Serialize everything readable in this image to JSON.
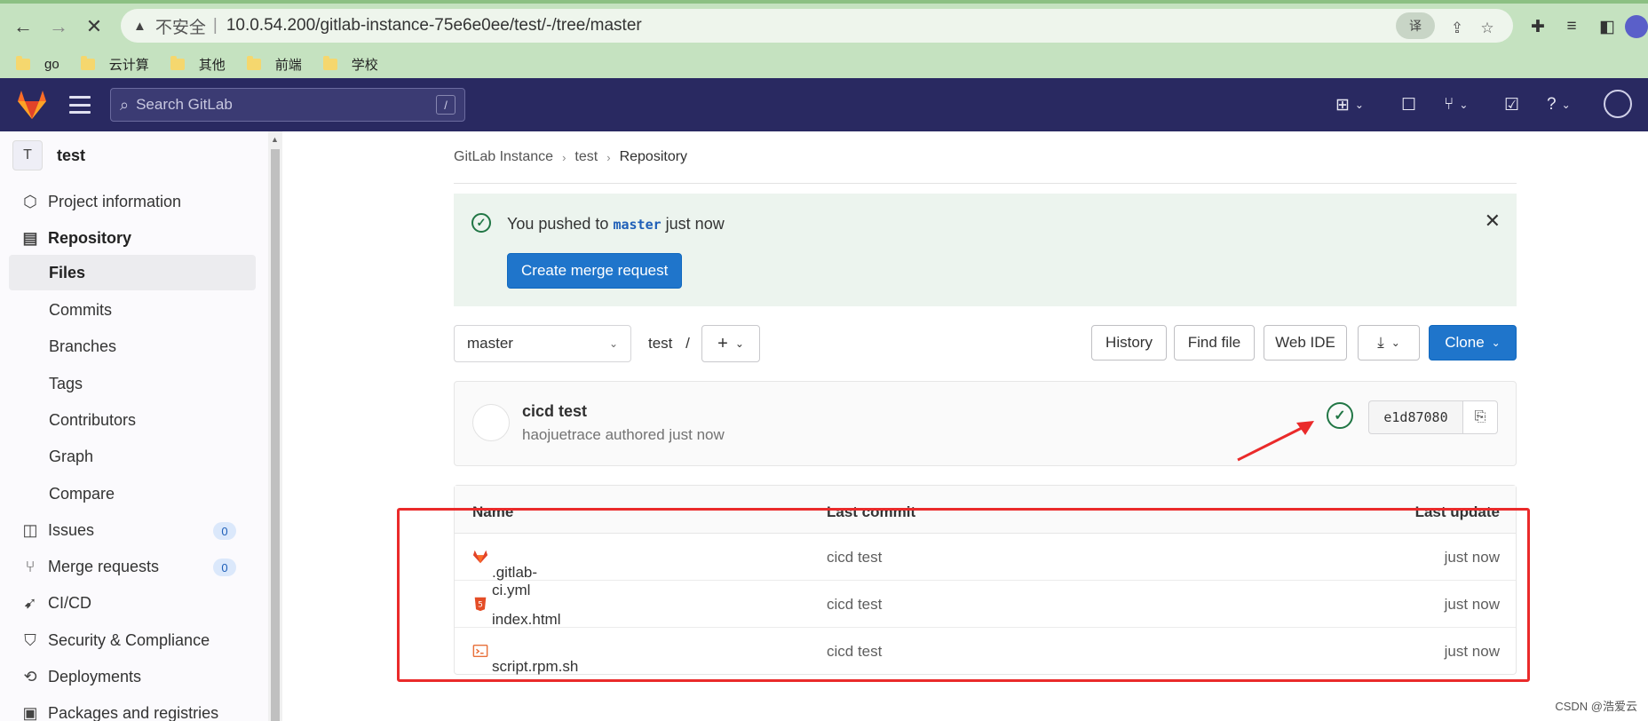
{
  "browser": {
    "insecure_label": "不安全",
    "separator": "|",
    "url": "10.0.54.200/gitlab-instance-75e6e0ee/test/-/tree/master",
    "bookmarks": [
      "go",
      "云计算",
      "其他",
      "前端",
      "学校"
    ]
  },
  "topbar": {
    "search_placeholder": "Search GitLab",
    "search_shortcut": "/"
  },
  "sidebar": {
    "project_initial": "T",
    "project_name": "test",
    "items": [
      {
        "label": "Project information"
      },
      {
        "label": "Repository"
      },
      {
        "label": "Files"
      },
      {
        "label": "Commits"
      },
      {
        "label": "Branches"
      },
      {
        "label": "Tags"
      },
      {
        "label": "Contributors"
      },
      {
        "label": "Graph"
      },
      {
        "label": "Compare"
      },
      {
        "label": "Issues",
        "count": "0"
      },
      {
        "label": "Merge requests",
        "count": "0"
      },
      {
        "label": "CI/CD"
      },
      {
        "label": "Security & Compliance"
      },
      {
        "label": "Deployments"
      },
      {
        "label": "Packages and registries"
      }
    ]
  },
  "breadcrumb": [
    "GitLab Instance",
    "test",
    "Repository"
  ],
  "alert": {
    "prefix": "You pushed to",
    "branch": "master",
    "suffix": "just now",
    "button": "Create merge request"
  },
  "toolbar": {
    "branch": "master",
    "path": "test",
    "path_sep": "/",
    "history": "History",
    "find_file": "Find file",
    "web_ide": "Web IDE",
    "clone": "Clone"
  },
  "commit": {
    "title": "cicd test",
    "meta": "haojuetrace authored just now",
    "sha": "e1d87080"
  },
  "table": {
    "headers": [
      "Name",
      "Last commit",
      "Last update"
    ],
    "rows": [
      {
        "name": ".gitlab-ci.yml",
        "commit": "cicd test",
        "update": "just now",
        "icon": "gitlab-icon"
      },
      {
        "name": "index.html",
        "commit": "cicd test",
        "update": "just now",
        "icon": "html5-icon"
      },
      {
        "name": "script.rpm.sh",
        "commit": "cicd test",
        "update": "just now",
        "icon": "terminal-icon"
      }
    ]
  },
  "watermark": "CSDN @浩爱云"
}
